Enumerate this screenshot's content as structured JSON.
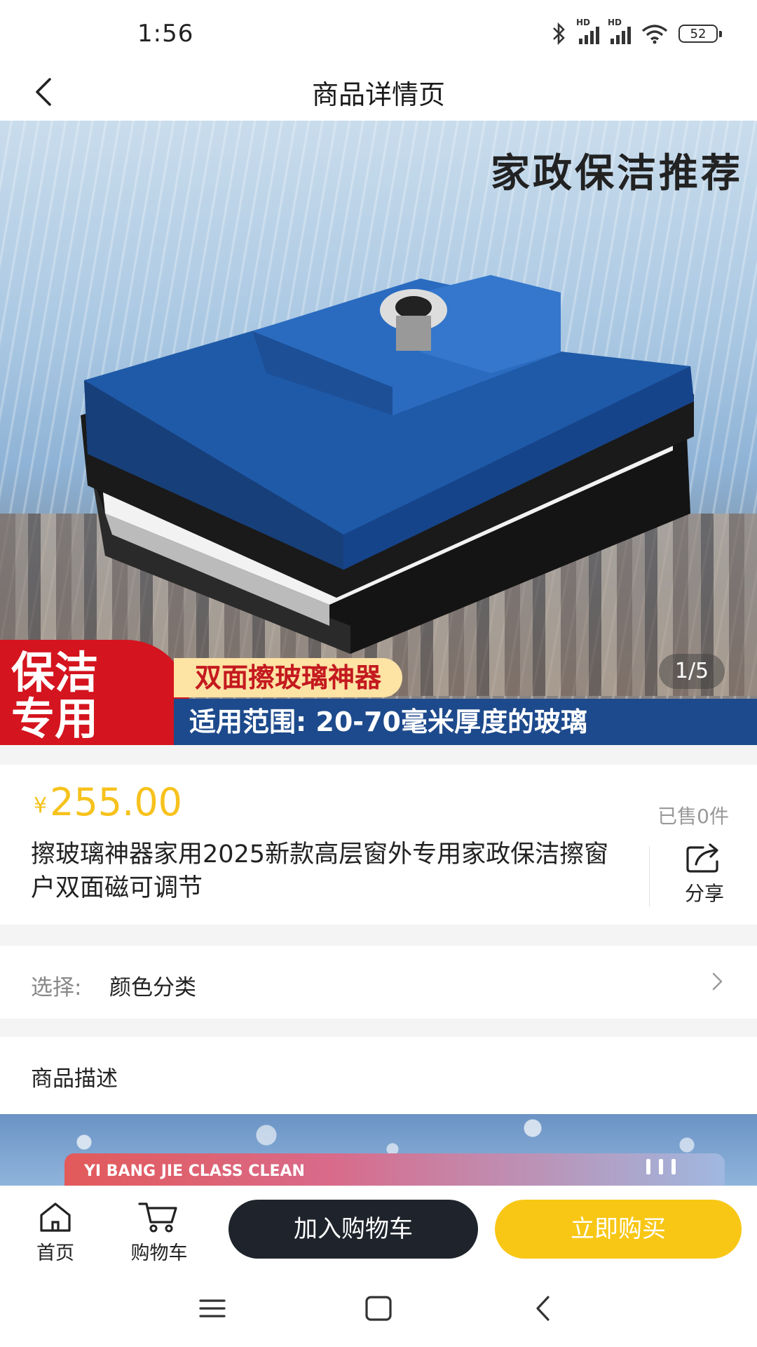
{
  "status_bar": {
    "time": "1:56",
    "signal1_label": "HD",
    "signal2_label": "HD",
    "battery": "52"
  },
  "nav": {
    "title": "商品详情页"
  },
  "hero": {
    "headline": "家政保洁推荐",
    "badge_line1": "保洁",
    "badge_line2": "专用",
    "tag1": "双面擦玻璃神器",
    "tag2": "适用范围: 20-70毫米厚度的玻璃",
    "counter": "1/5"
  },
  "product": {
    "currency": "¥",
    "price": "255.00",
    "sold": "已售0件",
    "title": "擦玻璃神器家用2025新款高层窗外专用家政保洁擦窗户双面磁可调节",
    "share_label": "分享"
  },
  "select": {
    "key": "选择:",
    "value": "颜色分类"
  },
  "description": {
    "title": "商品描述",
    "banner_text": "YI BANG JIE CLASS CLEAN"
  },
  "bottom_bar": {
    "home_label": "首页",
    "cart_label": "购物车",
    "add_to_cart": "加入购物车",
    "buy_now": "立即购买"
  },
  "colors": {
    "accent": "#f8c715",
    "dark_button": "#1f242c",
    "price": "#f6c21c"
  }
}
